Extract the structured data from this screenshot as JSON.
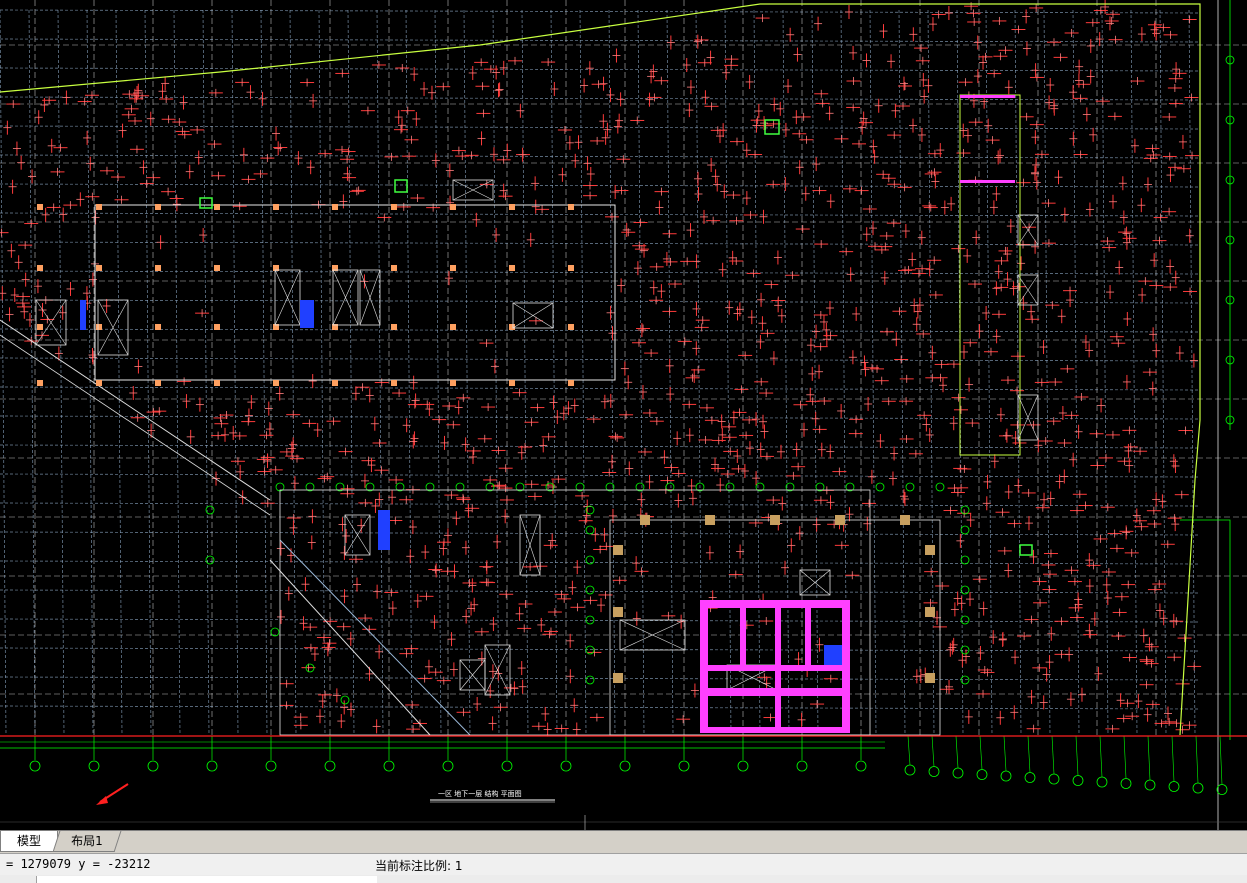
{
  "tabs": [
    {
      "label": "模型"
    },
    {
      "label": "布局1"
    }
  ],
  "status": {
    "coordinates": "= 1279079 y = -23212",
    "scale_label": "当前标注比例: 1"
  },
  "colors": {
    "background": "#000000",
    "grid": "#ffffff",
    "axis": "#00ff00",
    "rebar": "#ff3b3b",
    "beam": "#9ab8d8",
    "column": "#ffa060",
    "wall": "#ff40ff",
    "boundary": "#c8ff40",
    "ucs_arrow": "#ff2020"
  },
  "drawing": {
    "title": "一区 地下一层 结构 平面图"
  }
}
